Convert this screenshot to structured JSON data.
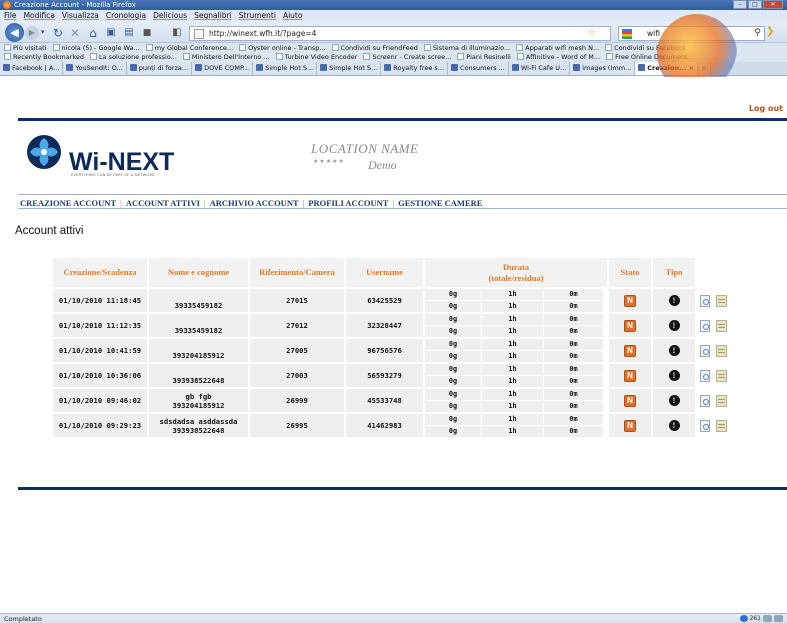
{
  "window": {
    "title": "Creazione Account - Mozilla Firefox",
    "controls": {
      "minimize": "–",
      "maximize": "□",
      "close": "✕"
    }
  },
  "menu": [
    "File",
    "Modifica",
    "Visualizza",
    "Cronologia",
    "Delicious",
    "Segnalibri",
    "Strumenti",
    "Aiuto"
  ],
  "navbar": {
    "url": "http://winext.wfh.it/?page=4",
    "search_value": "wifi"
  },
  "bookmarks_row1": [
    "Più visitati",
    "nicola (5) - Google Wa...",
    "my Global Conference...",
    "Oyster online - Transp...",
    "Condividi su FriendFeed",
    "Sistema di illuminazio...",
    "Apparati wifi mesh N...",
    "Condividi su Facebook"
  ],
  "bookmarks_row2": [
    "Recently Bookmarked",
    "La soluzione professio...",
    "Ministero Dell'Interno ...",
    "Turbine Video Encoder",
    "Screenr - Create scree...",
    "Piani Resinelli",
    "Affinitive - Word of M...",
    "Free Online Document..."
  ],
  "tabs": [
    "Facebook | A...",
    "YouSendIt: O...",
    "punti di forza...",
    "DOVE COMP...",
    "Simple Hot S...",
    "Simple Hot S...",
    "Royalty free s...",
    "Consumers ...",
    "Wi-Fi Cafe U...",
    "images (Imm...",
    "Creazion..."
  ],
  "active_tab_index": 10,
  "tabs_extra": {
    "close": "×",
    "new": "+"
  },
  "page": {
    "logout": "Log out",
    "logo_text": "Wi-NEXT",
    "logo_tagline": "EVERYTHING CAN BE PART OF A NETWORK",
    "location_name": "LOCATION NAME",
    "stars": "★★★★★",
    "location_sub": "Demo",
    "nav": [
      "CREAZIONE ACCOUNT",
      "ACCOUNT ATTIVI",
      "ARCHIVIO ACCOUNT",
      "PROFILI ACCOUNT",
      "GESTIONE CAMERE"
    ],
    "nav_sep": "|",
    "heading": "Account attivi"
  },
  "table": {
    "headers": {
      "created": "Creazione/Scadenza",
      "name": "Nome e cognome",
      "ref": "Riferimento/Camera",
      "user": "Username",
      "duration_l1": "Durata",
      "duration_l2": "(totale/residua)",
      "status": "Stato",
      "type": "Tipo"
    },
    "status_glyph": "N",
    "type_glyph": "!",
    "rows": [
      {
        "created": "01/10/2010 11:18:45",
        "name_1": "",
        "name_2": "39335459182",
        "ref": "27015",
        "user": "63425529",
        "d": [
          "0g",
          "1h",
          "0m"
        ],
        "r": [
          "0g",
          "1h",
          "0m"
        ]
      },
      {
        "created": "01/10/2010 11:12:35",
        "name_1": "",
        "name_2": "39335459182",
        "ref": "27012",
        "user": "32328447",
        "d": [
          "0g",
          "1h",
          "0m"
        ],
        "r": [
          "0g",
          "1h",
          "0m"
        ]
      },
      {
        "created": "01/10/2010 10:41:59",
        "name_1": "",
        "name_2": "393204185912",
        "ref": "27005",
        "user": "96756576",
        "d": [
          "0g",
          "1h",
          "0m"
        ],
        "r": [
          "0g",
          "1h",
          "0m"
        ]
      },
      {
        "created": "01/10/2010 10:36:06",
        "name_1": "",
        "name_2": "393938522648",
        "ref": "27003",
        "user": "56593279",
        "d": [
          "0g",
          "1h",
          "0m"
        ],
        "r": [
          "0g",
          "1h",
          "0m"
        ]
      },
      {
        "created": "01/10/2010 09:46:02",
        "name_1": "gb fgb",
        "name_2": "393204185912",
        "ref": "26999",
        "user": "45533748",
        "d": [
          "0g",
          "1h",
          "0m"
        ],
        "r": [
          "0g",
          "1h",
          "0m"
        ]
      },
      {
        "created": "01/10/2010 09:29:23",
        "name_1": "sdsdadsa asddassda",
        "name_2": "393938522648",
        "ref": "26995",
        "user": "41462983",
        "d": [
          "0g",
          "1h",
          "0m"
        ],
        "r": [
          "0g",
          "1h",
          "0m"
        ]
      }
    ]
  },
  "statusbar": {
    "text": "Completato",
    "zoom": "261"
  },
  "colors": {
    "brand_navy": "#0b2f6a",
    "header_orange": "#e17a25",
    "logout": "#b3541e",
    "badge_orange": "#e3702a"
  }
}
